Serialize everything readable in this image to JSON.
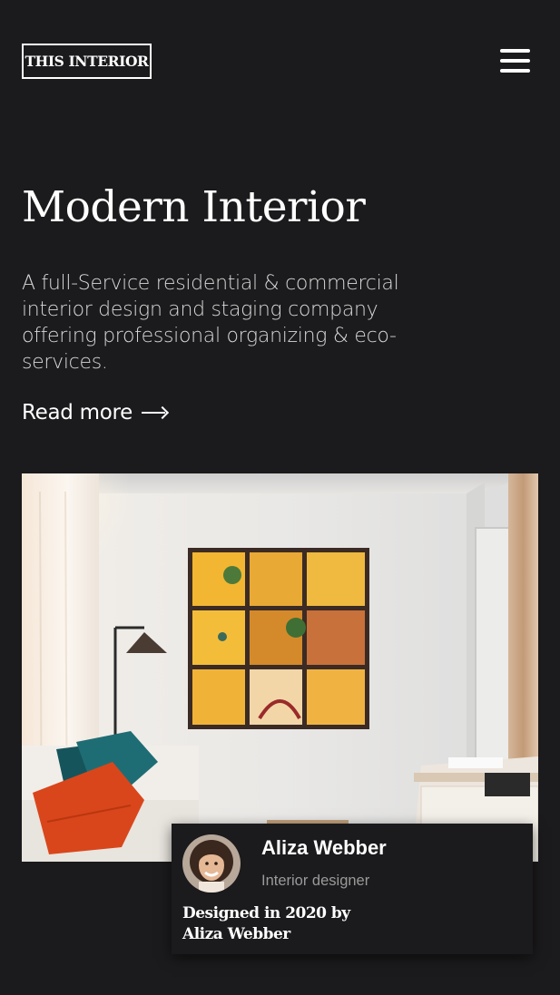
{
  "header": {
    "logo_text": "THIS INTERIOR",
    "menu_icon": "hamburger-menu-icon"
  },
  "hero": {
    "title": "Modern Interior",
    "description": "A full-Service residential & commercial interior design and staging company offering professional organizing & eco-services.",
    "read_more_label": "Read more",
    "read_more_icon": "arrow-right-icon"
  },
  "showcase": {
    "image_subject": "living room interior with yellow framed wall art, floor lamp, sofa with orange and teal cushions",
    "designer": {
      "name": "Aliza Webber",
      "role": "Interior designer",
      "credit": "Designed in 2020 by Aliza Webber"
    }
  },
  "colors": {
    "background": "#1b1a1c",
    "text": "#ffffff",
    "muted": "#9a9a9a"
  }
}
